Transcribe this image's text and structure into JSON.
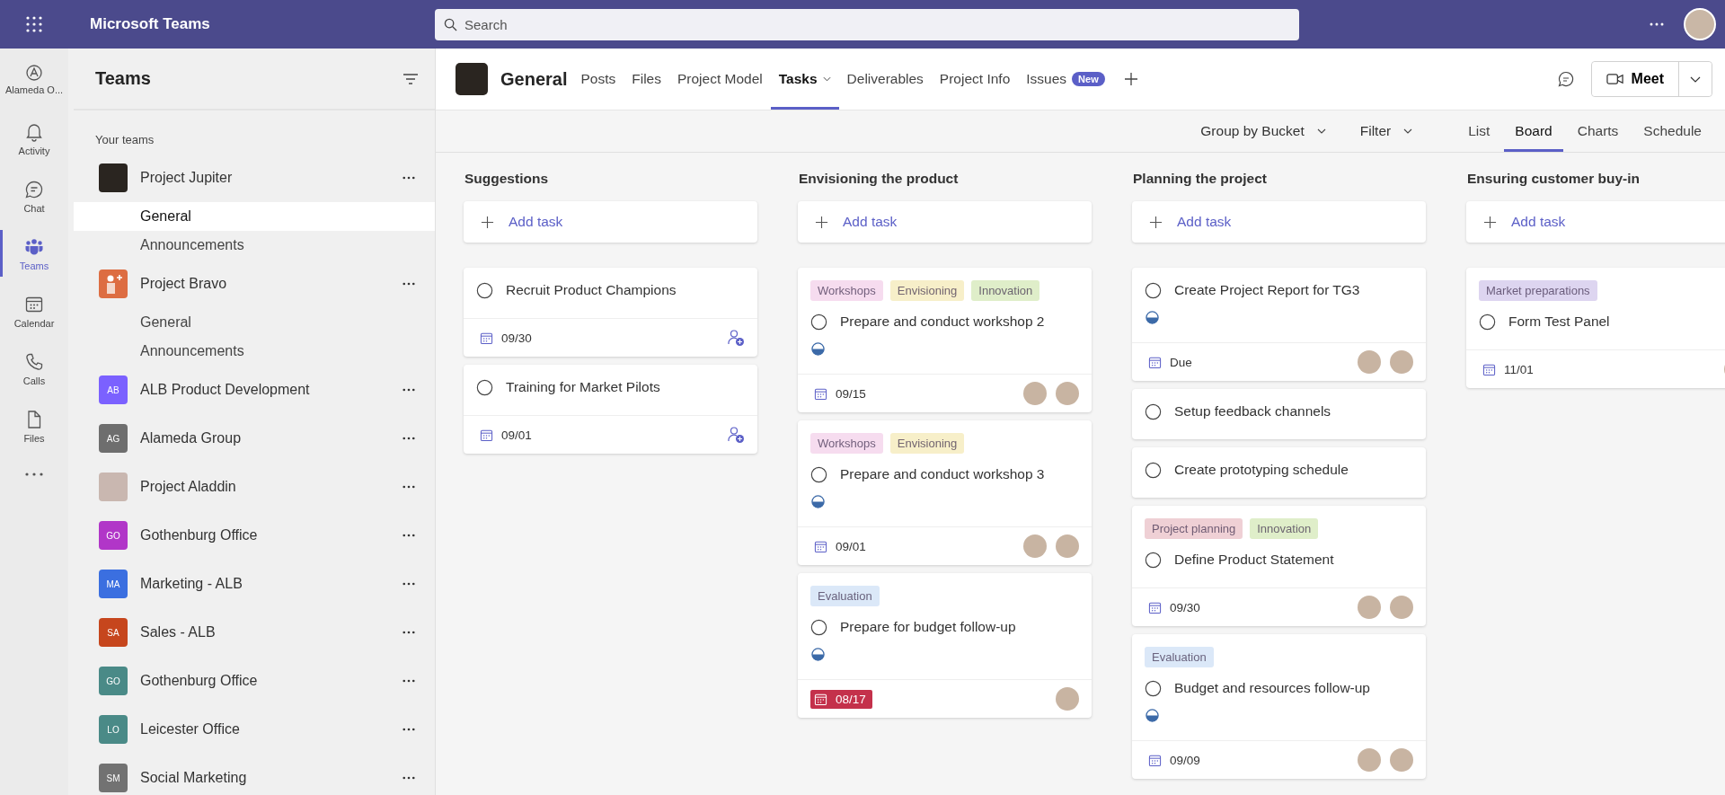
{
  "app_bar": {
    "title": "Microsoft Teams",
    "search": {
      "placeholder": "Search"
    }
  },
  "rail": {
    "org": {
      "label": "Alameda O..."
    },
    "items": [
      {
        "label": "Activity",
        "selected": false
      },
      {
        "label": "Chat",
        "selected": false
      },
      {
        "label": "Teams",
        "selected": true
      },
      {
        "label": "Calendar",
        "selected": false
      },
      {
        "label": "Calls",
        "selected": false
      },
      {
        "label": "Files",
        "selected": false
      }
    ]
  },
  "sidebar": {
    "title": "Teams",
    "section": "Your teams",
    "teams": [
      {
        "name": "Project Jupiter",
        "kind": "picture",
        "channels": [
          {
            "name": "General",
            "selected": true
          },
          {
            "name": "Announcements",
            "selected": false
          }
        ]
      },
      {
        "name": "Project Bravo",
        "kind": "icon",
        "color": "#dd6d42",
        "channels": [
          {
            "name": "General",
            "selected": false
          },
          {
            "name": "Announcements",
            "selected": false
          }
        ]
      },
      {
        "name": "ALB Product Development",
        "kind": "initials",
        "initials": "AB",
        "color": "#7b61ff"
      },
      {
        "name": "Alameda Group",
        "kind": "initials",
        "initials": "AG",
        "color": "#6e6e6e"
      },
      {
        "name": "Project Aladdin",
        "kind": "picture"
      },
      {
        "name": "Gothenburg Office",
        "kind": "initials",
        "initials": "GO",
        "color": "#b136c8"
      },
      {
        "name": "Marketing - ALB",
        "kind": "initials",
        "initials": "MA",
        "color": "#3b6fe0"
      },
      {
        "name": "Sales - ALB",
        "kind": "initials",
        "initials": "SA",
        "color": "#c6461d"
      },
      {
        "name": "Gothenburg Office",
        "kind": "initials",
        "initials": "GO",
        "color": "#4a8a87"
      },
      {
        "name": "Leicester Office",
        "kind": "initials",
        "initials": "LO",
        "color": "#4a8a87"
      },
      {
        "name": "Social Marketing",
        "kind": "initials",
        "initials": "SM",
        "color": "#727272"
      }
    ]
  },
  "channel": {
    "title": "General",
    "tabs": [
      {
        "label": "Posts",
        "selected": false
      },
      {
        "label": "Files",
        "selected": false
      },
      {
        "label": "Project Model",
        "selected": false
      },
      {
        "label": "Tasks",
        "selected": true,
        "dropdown": true
      },
      {
        "label": "Deliverables",
        "selected": false
      },
      {
        "label": "Project Info",
        "selected": false
      },
      {
        "label": "Issues",
        "selected": false,
        "badge": "New"
      }
    ],
    "meet": "Meet"
  },
  "toolbar": {
    "group_by": "Group by Bucket",
    "filter": "Filter",
    "views": [
      {
        "label": "List",
        "selected": false
      },
      {
        "label": "Board",
        "selected": true
      },
      {
        "label": "Charts",
        "selected": false
      },
      {
        "label": "Schedule",
        "selected": false
      }
    ]
  },
  "board": {
    "buckets": [
      {
        "title": "Suggestions",
        "add_label": "Add task",
        "cards": [
          {
            "title": "Recruit Product Champions",
            "completed": false,
            "in_progress": false,
            "date": "09/30",
            "overdue": false
          },
          {
            "title": "Training for Market Pilots",
            "completed": false,
            "in_progress": false,
            "date": "09/01",
            "overdue": false
          }
        ]
      },
      {
        "title": "Envisioning the product",
        "add_label": "Add task",
        "cards": [
          {
            "tags": [
              {
                "label": "Workshops",
                "color": "#f6dcef"
              },
              {
                "label": "Envisioning",
                "color": "#f7efc9"
              },
              {
                "label": "Innovation",
                "color": "#dfeec9"
              }
            ],
            "title": "Prepare and conduct workshop 2",
            "completed": false,
            "in_progress": true,
            "date": "09/15",
            "overdue": false,
            "assignees": [
              {
                "kind": "photo"
              },
              {
                "kind": "photo"
              }
            ]
          },
          {
            "tags": [
              {
                "label": "Workshops",
                "color": "#f6dcef"
              },
              {
                "label": "Envisioning",
                "color": "#f7efc9"
              }
            ],
            "title": "Prepare and conduct workshop 3",
            "completed": false,
            "in_progress": true,
            "date": "09/01",
            "overdue": false,
            "assignees": [
              {
                "kind": "photo"
              },
              {
                "kind": "photo"
              }
            ]
          },
          {
            "tags": [
              {
                "label": "Evaluation",
                "color": "#dbe8f8"
              }
            ],
            "title": "Prepare for budget follow-up",
            "completed": false,
            "in_progress": true,
            "date": "08/17",
            "overdue": true,
            "assignees": [
              {
                "kind": "photo"
              }
            ]
          }
        ]
      },
      {
        "title": "Planning the project",
        "add_label": "Add task",
        "cards": [
          {
            "title": "Create Project Report for TG3",
            "completed": false,
            "in_progress": true,
            "date": "Due",
            "overdue": false,
            "assignees": [
              {
                "kind": "photo"
              },
              {
                "kind": "photo"
              }
            ]
          },
          {
            "title": "Setup feedback channels",
            "completed": false,
            "in_progress": false
          },
          {
            "title": "Create prototyping schedule",
            "completed": false,
            "in_progress": false
          },
          {
            "tags": [
              {
                "label": "Project planning",
                "color": "#efd0d5"
              },
              {
                "label": "Innovation",
                "color": "#dfeec9"
              }
            ],
            "title": "Define Product Statement",
            "completed": false,
            "in_progress": false,
            "date": "09/30",
            "overdue": false,
            "assignees": [
              {
                "kind": "photo"
              },
              {
                "kind": "photo"
              }
            ]
          },
          {
            "tags": [
              {
                "label": "Evaluation",
                "color": "#dbe8f8"
              }
            ],
            "title": "Budget and resources follow-up",
            "completed": false,
            "in_progress": true,
            "date": "09/09",
            "overdue": false,
            "assignees": [
              {
                "kind": "photo"
              },
              {
                "kind": "photo"
              }
            ]
          }
        ]
      },
      {
        "title": "Ensuring customer buy-in",
        "add_label": "Add task",
        "cards": [
          {
            "tags": [
              {
                "label": "Market preparations",
                "color": "#ddd5f0"
              }
            ],
            "title": "Form Test Panel",
            "completed": false,
            "in_progress": false,
            "date": "11/01",
            "overdue": false,
            "assignees": [
              {
                "kind": "photo"
              }
            ]
          }
        ]
      }
    ]
  }
}
